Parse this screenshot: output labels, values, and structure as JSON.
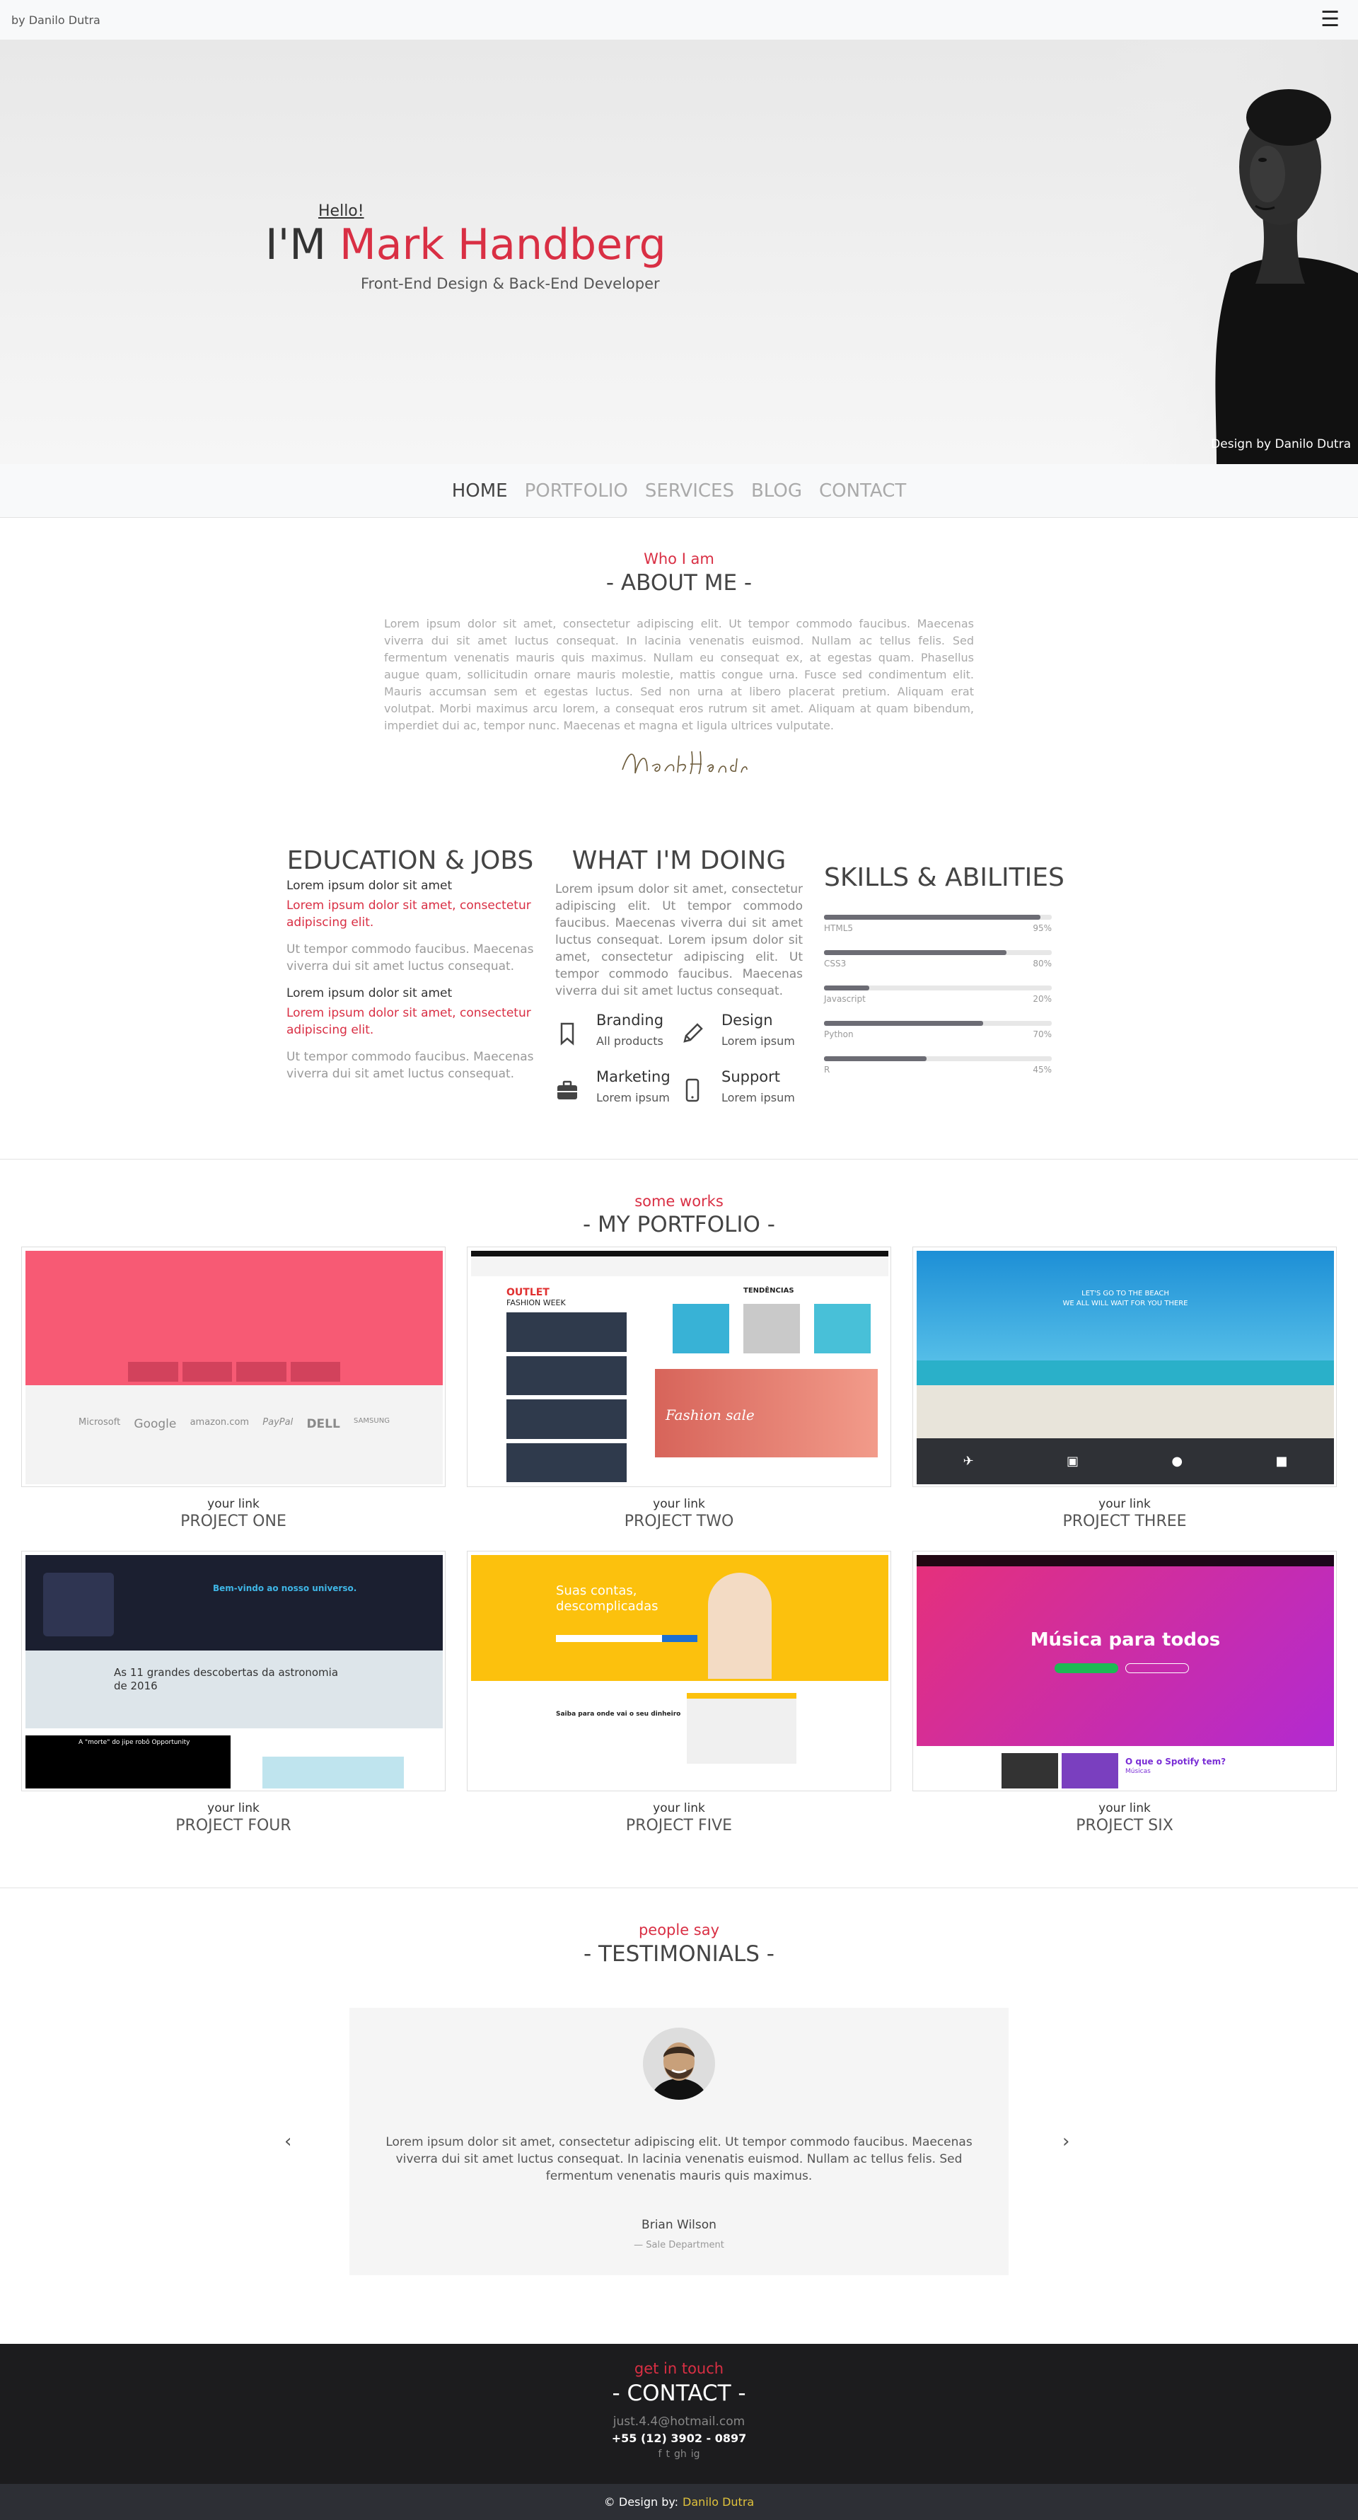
{
  "topbar": {
    "brand": "by Danilo Dutra",
    "menu_icon": "hamburger-icon"
  },
  "hero": {
    "hello": "Hello!",
    "name_prefix": "I'M ",
    "name": "Mark Handberg",
    "subtitle": "Front-End Design & Back-End Developer",
    "credit": "Design by Danilo Dutra"
  },
  "nav": {
    "items": [
      "HOME",
      "PORTFOLIO",
      "SERVICES",
      "BLOG",
      "CONTACT"
    ],
    "active": "HOME"
  },
  "about": {
    "kicker": "Who I am",
    "title": "- ABOUT ME -",
    "text": "Lorem ipsum dolor sit amet, consectetur adipiscing elit. Ut tempor commodo faucibus. Maecenas viverra dui sit amet luctus consequat. In lacinia venenatis euismod. Nullam ac tellus felis. Sed fermentum venenatis mauris quis maximus. Nullam eu consequat ex, at egestas quam. Phasellus augue quam, sollicitudin ornare mauris molestie, mattis congue urna. Fusce sed condimentum elit. Mauris accumsan sem et egestas luctus. Sed non urna at libero placerat pretium. Aliquam erat volutpat. Morbi maximus arcu lorem, a consequat eros rutrum sit amet. Aliquam at quam bibendum, imperdiet dui ac, tempor nunc. Maecenas et magna et ligula ultrices vulputate.",
    "signature": "Mark Handberg"
  },
  "education": {
    "title": "EDUCATION & JOBS",
    "entries": [
      {
        "heading": "Lorem ipsum dolor sit amet",
        "highlight": "Lorem ipsum dolor sit amet, consectetur adipiscing elit.",
        "detail": "Ut tempor commodo faucibus. Maecenas viverra dui sit amet luctus consequat."
      },
      {
        "heading": "Lorem ipsum dolor sit amet",
        "highlight": "Lorem ipsum dolor sit amet, consectetur adipiscing elit.",
        "detail": "Ut tempor commodo faucibus. Maecenas viverra dui sit amet luctus consequat."
      }
    ]
  },
  "doing": {
    "title": "WHAT I'M DOING",
    "text": "Lorem ipsum dolor sit amet, consectetur adipiscing elit. Ut tempor commodo faucibus. Maecenas viverra dui sit amet luctus consequat. Lorem ipsum dolor sit amet, consectetur adipiscing elit. Ut tempor commodo faucibus. Maecenas viverra dui sit amet luctus consequat.",
    "services": [
      {
        "icon": "bookmark-icon",
        "title": "Branding",
        "sub": "All products"
      },
      {
        "icon": "pencil-icon",
        "title": "Design",
        "sub": "Lorem ipsum"
      },
      {
        "icon": "briefcase-icon",
        "title": "Marketing",
        "sub": "Lorem ipsum"
      },
      {
        "icon": "mobile-icon",
        "title": "Support",
        "sub": "Lorem ipsum"
      }
    ]
  },
  "skills": {
    "title": "SKILLS & ABILITIES",
    "items": [
      {
        "name": "HTML5",
        "pct": "95%",
        "value": 95
      },
      {
        "name": "CSS3",
        "pct": "80%",
        "value": 80
      },
      {
        "name": "Javascript",
        "pct": "20%",
        "value": 20
      },
      {
        "name": "Python",
        "pct": "70%",
        "value": 70
      },
      {
        "name": "R",
        "pct": "45%",
        "value": 45
      }
    ]
  },
  "portfolio": {
    "kicker": "some works",
    "title": "- MY PORTFOLIO -",
    "projects": [
      {
        "link": "your link",
        "name": "PROJECT ONE"
      },
      {
        "link": "your link",
        "name": "PROJECT TWO"
      },
      {
        "link": "your link",
        "name": "PROJECT THREE"
      },
      {
        "link": "your link",
        "name": "PROJECT FOUR"
      },
      {
        "link": "your link",
        "name": "PROJECT FIVE"
      },
      {
        "link": "your link",
        "name": "PROJECT SIX"
      }
    ],
    "thumb_text": {
      "p2_outlet": "OUTLET",
      "p2_week": "FASHION WEEK",
      "p2_trends": "TENDÊNCIAS",
      "p2_sale": "Fashion sale",
      "p3_headline": "LET'S GO TO THE BEACH",
      "p3_sub": "WE ALL WILL WAIT FOR YOU THERE",
      "p4_welcome": "Bem-vindo ao nosso universo.",
      "p4_article": "As 11 grandes descobertas da astronomia de 2016",
      "p4_more": "A \"morte\" do jipe robô Opportunity",
      "p5_headline": "Suas contas, descomplicadas",
      "p5_sub": "Saiba para onde vai o seu dinheiro",
      "p6_headline": "Música para todos",
      "p6_question": "O que o Spotify tem?",
      "p6_music": "Músicas",
      "p1_logos": [
        "Microsoft",
        "Google",
        "amazon.com",
        "PayPal",
        "DELL",
        "SAMSUNG"
      ]
    }
  },
  "testimonials": {
    "kicker": "people say",
    "title": "- TESTIMONIALS -",
    "quote": "Lorem ipsum dolor sit amet, consectetur adipiscing elit. Ut tempor commodo faucibus. Maecenas viverra dui sit amet luctus consequat. In lacinia venenatis euismod. Nullam ac tellus felis. Sed fermentum venenatis mauris quis maximus.",
    "author": "Brian Wilson",
    "department": "— Sale Department",
    "prev": "‹",
    "next": "›"
  },
  "contact": {
    "kicker": "get in touch",
    "title": "- CONTACT -",
    "email": "just.4.4@hotmail.com",
    "phone": "+55 (12) 3902 - 0897",
    "social": [
      "f",
      "t",
      "gh",
      "ig"
    ]
  },
  "footer": {
    "prefix": "© Design by:",
    "author": "Danilo Dutra"
  },
  "colors": {
    "accent": "#d92f44",
    "footer_bg": "#1c1c1e",
    "bar": "#6c6c74",
    "author": "#e0c23c"
  }
}
